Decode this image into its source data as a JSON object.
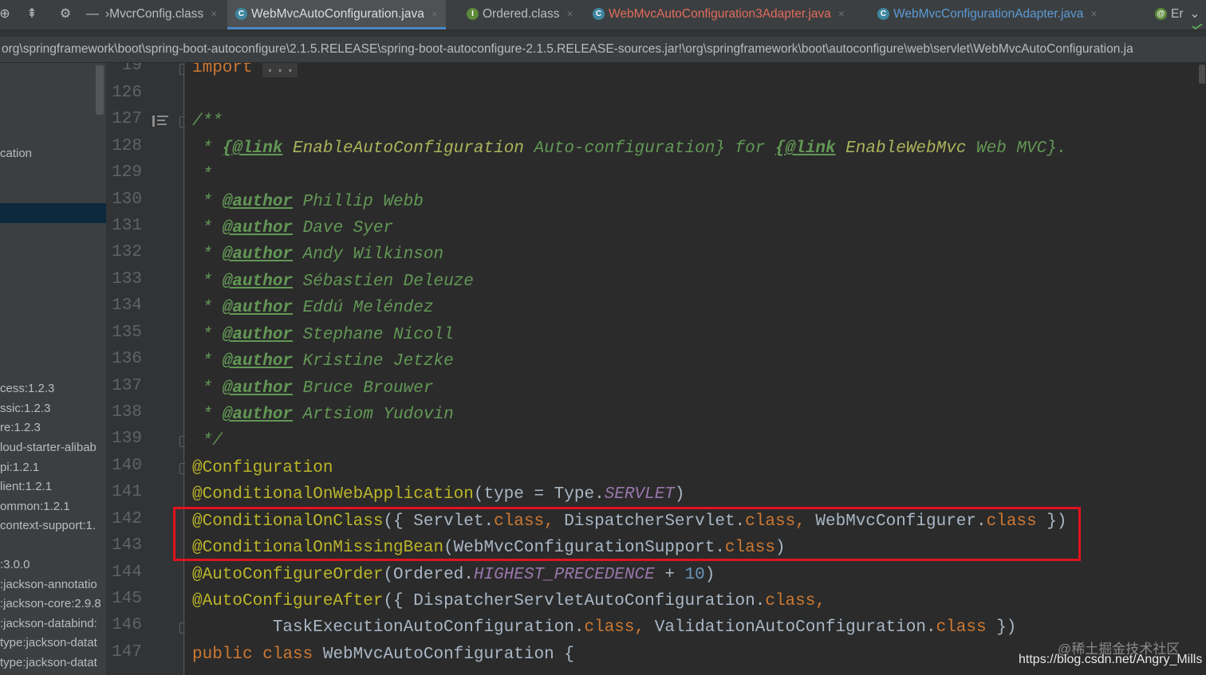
{
  "tabs": [
    {
      "label": "›MvcrConfig.class",
      "icon": "class-file-icon"
    },
    {
      "label": "WebMvcAutoConfiguration.java",
      "icon": "java-class-icon"
    },
    {
      "label": "Ordered.class",
      "icon": "interface-icon"
    },
    {
      "label": "WebMvcAutoConfiguration3Adapter.java",
      "icon": "java-class-icon"
    },
    {
      "label": "WebMvcConfigurationAdapter.java",
      "icon": "java-class-icon"
    },
    {
      "label": "Er",
      "icon": "annotation-icon"
    }
  ],
  "colors": {
    "active_tab_underline": "#4a88c7",
    "error_tab_text": "#e06c5a",
    "highlight_box": "#e0131f"
  },
  "path": "org\\springframework\\boot\\spring-boot-autoconfigure\\2.1.5.RELEASE\\spring-boot-autoconfigure-2.1.5.RELEASE-sources.jar!\\org\\springframework\\boot\\autoconfigure\\web\\servlet\\WebMvcAutoConfiguration.ja",
  "tree": {
    "items": [
      "cation",
      "cess:1.2.3",
      "ssic:1.2.3",
      "re:1.2.3",
      "loud-starter-alibab",
      "pi:1.2.1",
      "lient:1.2.1",
      "ommon:1.2.1",
      "context-support:1.",
      ":3.0.0",
      ":jackson-annotatio",
      ":jackson-core:2.9.8",
      ":jackson-databind:",
      "type:jackson-datat",
      "type:jackson-datat"
    ]
  },
  "gutter": {
    "line_numbers": [
      "19",
      "126",
      "127",
      "128",
      "129",
      "130",
      "131",
      "132",
      "133",
      "134",
      "135",
      "136",
      "137",
      "138",
      "139",
      "140",
      "141",
      "142",
      "143",
      "144",
      "145",
      "146",
      "147"
    ]
  },
  "code": {
    "import": "import",
    "import_folded": "...",
    "doc_open": "/**",
    "doc_line1": {
      "star": " * ",
      "link1_tag": "{@link",
      "link1_name": "EnableAutoConfiguration",
      "link1_text": " Auto-configuration}",
      "for": " for ",
      "link2_tag": "{@link",
      "link2_name": "EnableWebMvc",
      "link2_text": " Web MVC}."
    },
    "doc_blank": " *",
    "author_tag": "@author",
    "authors": [
      "Phillip Webb",
      "Dave Syer",
      "Andy Wilkinson",
      "Sébastien Deleuze",
      "Eddú Meléndez",
      "Stephane Nicoll",
      "Kristine Jetzke",
      "Bruce Brouwer",
      "Artsiom Yudovin"
    ],
    "doc_close": " */",
    "ann_configuration": "@Configuration",
    "ann_web_app": "@ConditionalOnWebApplication",
    "web_app_args_pre": "(type = Type.",
    "web_app_const": "SERVLET",
    "web_app_args_post": ")",
    "ann_on_class": "@ConditionalOnClass",
    "on_class_a": "({ Servlet.",
    "on_class_b": " DispatcherServlet.",
    "on_class_c": " WebMvcConfigurer.",
    "on_class_end": " })",
    "ann_missing_bean": "@ConditionalOnMissingBean",
    "missing_bean_arg": "(WebMvcConfigurationSupport.",
    "missing_bean_end": ")",
    "ann_order": "@AutoConfigureOrder",
    "order_pre": "(Ordered.",
    "order_const": "HIGHEST_PRECEDENCE",
    "order_plus": " + ",
    "order_num": "10",
    "order_end": ")",
    "ann_after": "@AutoConfigureAfter",
    "after_a": "({ DispatcherServletAutoConfiguration.",
    "after_b_indent": "        TaskExecutionAutoConfiguration.",
    "after_c": " ValidationAutoConfiguration.",
    "after_end": " })",
    "kw_class": "class",
    "comma": ",",
    "kw_public": "public",
    "class_name": " WebMvcAutoConfiguration {"
  },
  "watermark": {
    "line1": "@稀土掘金技术社区",
    "line2": "https://blog.csdn.net/Angry_Mills"
  }
}
